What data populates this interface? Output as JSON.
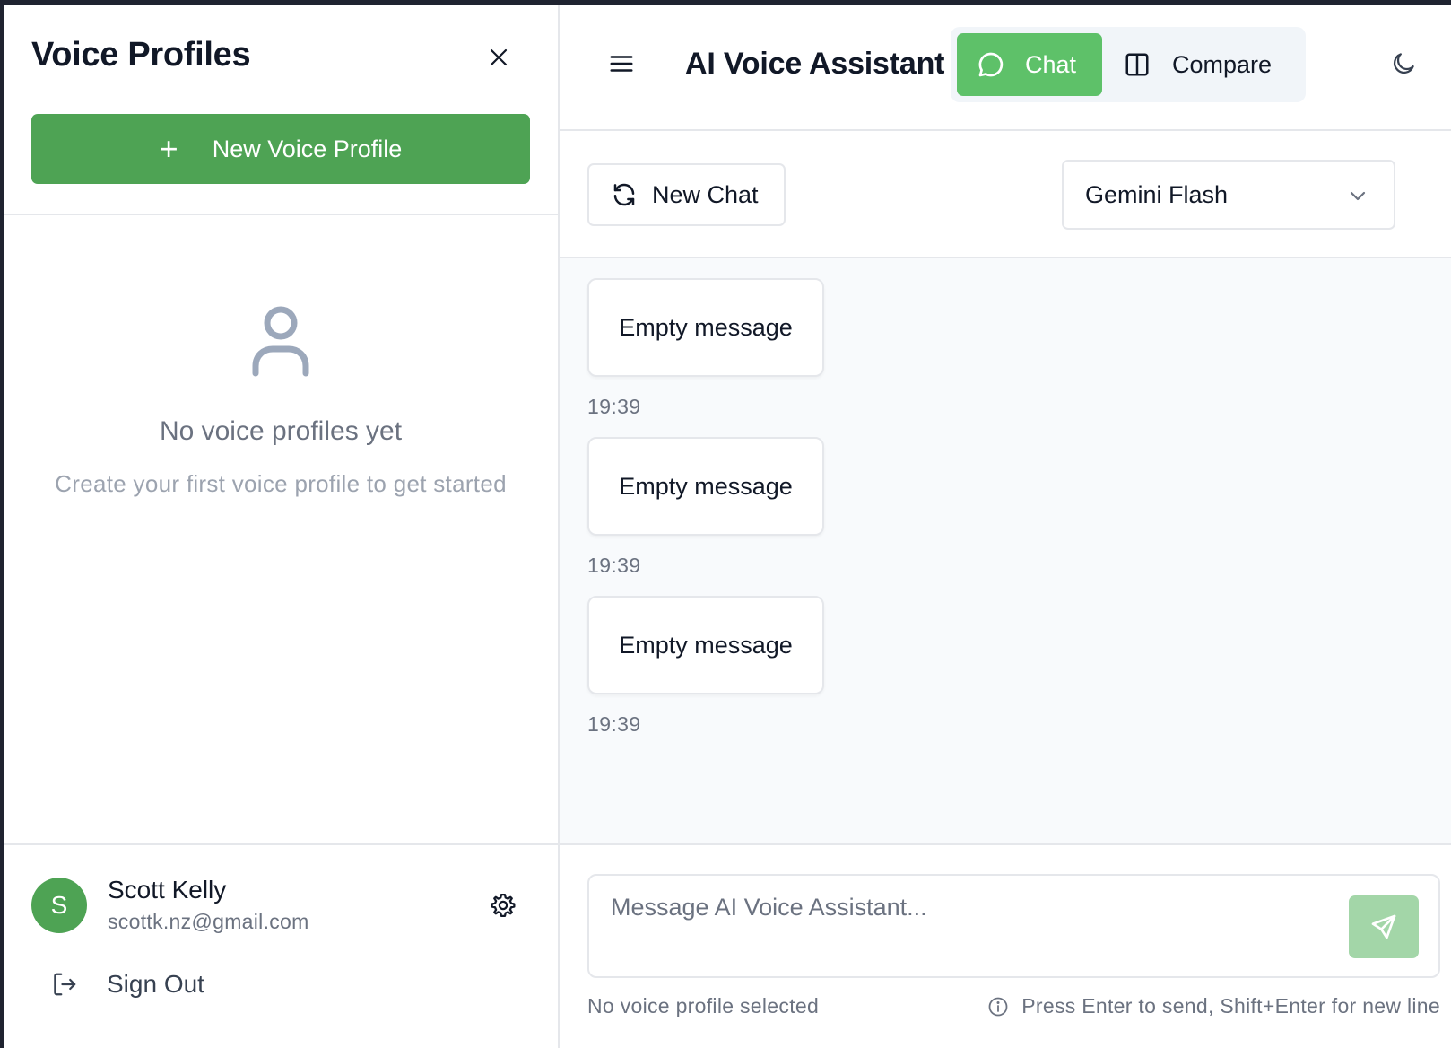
{
  "sidebar": {
    "title": "Voice Profiles",
    "new_profile_label": "New Voice Profile",
    "empty_title": "No voice profiles yet",
    "empty_subtitle": "Create your first voice profile to get started",
    "user": {
      "initial": "S",
      "name": "Scott Kelly",
      "email": "scottk.nz@gmail.com"
    },
    "sign_out_label": "Sign Out",
    "accent_color": "#4ea354"
  },
  "header": {
    "title": "AI Voice Assistant",
    "modes": [
      {
        "label": "Chat",
        "active": true
      },
      {
        "label": "Compare",
        "active": false
      }
    ]
  },
  "toolbar": {
    "new_chat_label": "New Chat",
    "model_selected": "Gemini Flash"
  },
  "messages": [
    {
      "text": "Empty message",
      "time": "19:39"
    },
    {
      "text": "Empty message",
      "time": "19:39"
    },
    {
      "text": "Empty message",
      "time": "19:39"
    }
  ],
  "composer": {
    "placeholder": "Message AI Voice Assistant...",
    "status": "No voice profile selected",
    "hint": "Press Enter to send, Shift+Enter for new line"
  },
  "icons": [
    "close-icon",
    "plus-icon",
    "user-icon",
    "settings-gear-icon",
    "sign-out-icon",
    "menu-icon",
    "chat-bubble-icon",
    "columns-icon",
    "moon-icon",
    "refresh-icon",
    "chevron-down-icon",
    "send-icon",
    "info-icon"
  ]
}
